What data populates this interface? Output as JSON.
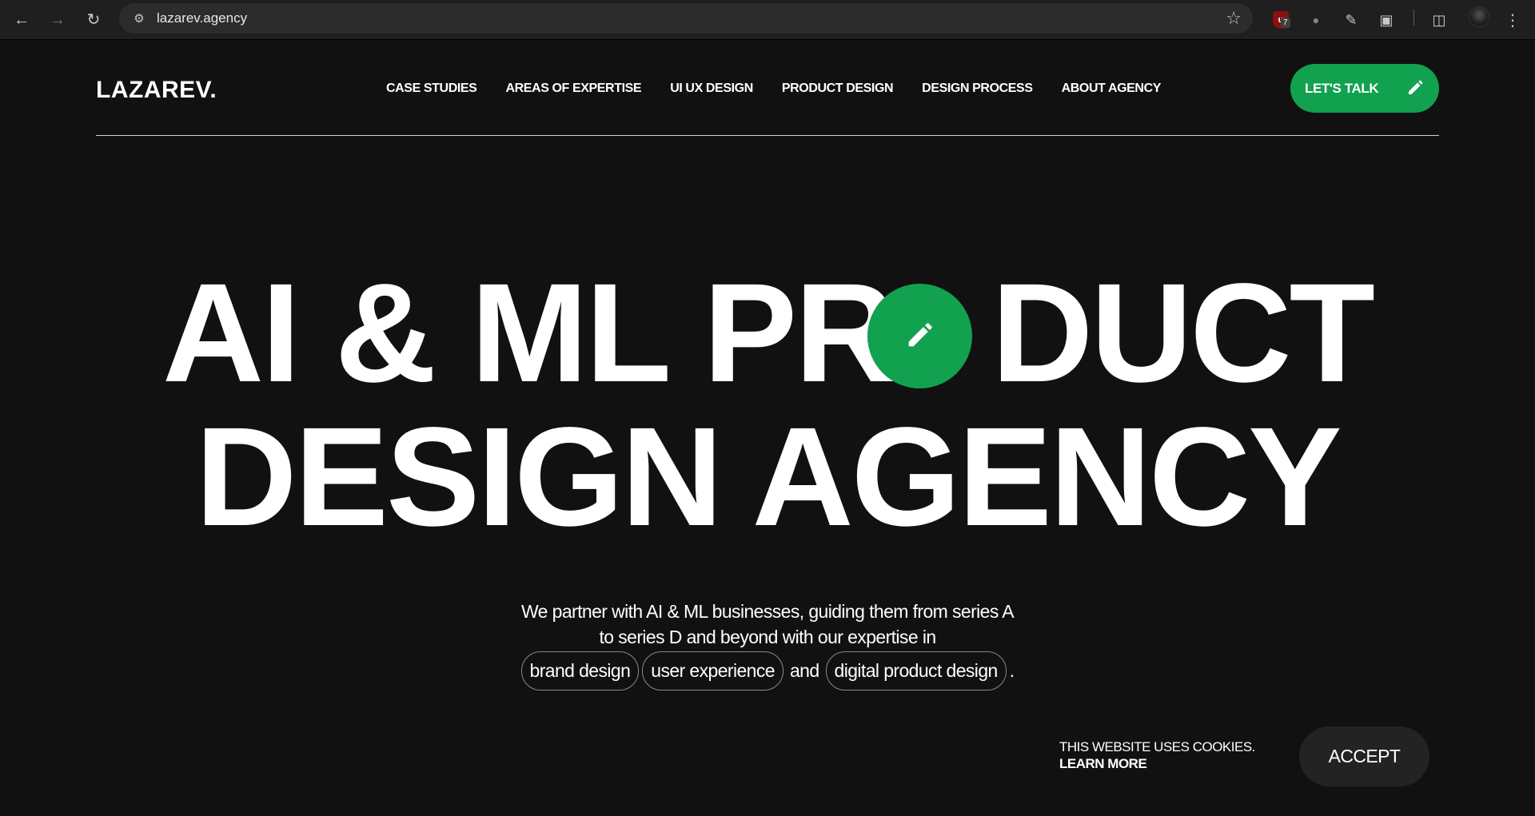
{
  "browser": {
    "url": "lazarev.agency",
    "extension_badge": "7"
  },
  "brand": {
    "logo": "LAZAREV.",
    "accent_color": "#12a14e",
    "background_color": "#111111"
  },
  "nav": {
    "items": [
      {
        "label": "CASE STUDIES"
      },
      {
        "label": "AREAS OF EXPERTISE"
      },
      {
        "label": "UI UX DESIGN"
      },
      {
        "label": "PRODUCT DESIGN"
      },
      {
        "label": "DESIGN PROCESS"
      },
      {
        "label": "ABOUT AGENCY"
      }
    ],
    "cta_label": "LET'S TALK",
    "cta_icon": "pencil-icon"
  },
  "hero": {
    "line1_part1": "AI & ML PR",
    "line1_part2": "DUCT",
    "line2": "DESIGN AGENCY",
    "badge_icon": "pencil-icon"
  },
  "intro": {
    "line1": "We partner with AI & ML businesses, guiding them from series A",
    "line2": "to series D and beyond with our expertise in",
    "chips": [
      "brand design",
      "user experience",
      "digital product design"
    ],
    "connector": "and",
    "end": "."
  },
  "cookie": {
    "notice": "THIS WEBSITE USES COOKIES.",
    "learn_more": "LEARN MORE",
    "accept_label": "ACCEPT"
  }
}
